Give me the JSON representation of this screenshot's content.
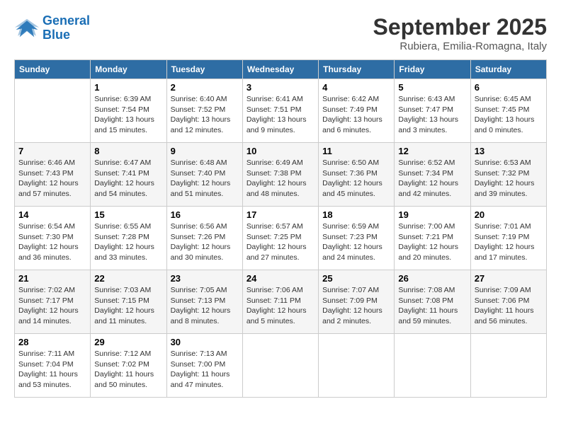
{
  "logo": {
    "line1": "General",
    "line2": "Blue"
  },
  "title": "September 2025",
  "subtitle": "Rubiera, Emilia-Romagna, Italy",
  "days_of_week": [
    "Sunday",
    "Monday",
    "Tuesday",
    "Wednesday",
    "Thursday",
    "Friday",
    "Saturday"
  ],
  "weeks": [
    [
      {
        "day": "",
        "info": ""
      },
      {
        "day": "1",
        "info": "Sunrise: 6:39 AM\nSunset: 7:54 PM\nDaylight: 13 hours\nand 15 minutes."
      },
      {
        "day": "2",
        "info": "Sunrise: 6:40 AM\nSunset: 7:52 PM\nDaylight: 13 hours\nand 12 minutes."
      },
      {
        "day": "3",
        "info": "Sunrise: 6:41 AM\nSunset: 7:51 PM\nDaylight: 13 hours\nand 9 minutes."
      },
      {
        "day": "4",
        "info": "Sunrise: 6:42 AM\nSunset: 7:49 PM\nDaylight: 13 hours\nand 6 minutes."
      },
      {
        "day": "5",
        "info": "Sunrise: 6:43 AM\nSunset: 7:47 PM\nDaylight: 13 hours\nand 3 minutes."
      },
      {
        "day": "6",
        "info": "Sunrise: 6:45 AM\nSunset: 7:45 PM\nDaylight: 13 hours\nand 0 minutes."
      }
    ],
    [
      {
        "day": "7",
        "info": "Sunrise: 6:46 AM\nSunset: 7:43 PM\nDaylight: 12 hours\nand 57 minutes."
      },
      {
        "day": "8",
        "info": "Sunrise: 6:47 AM\nSunset: 7:41 PM\nDaylight: 12 hours\nand 54 minutes."
      },
      {
        "day": "9",
        "info": "Sunrise: 6:48 AM\nSunset: 7:40 PM\nDaylight: 12 hours\nand 51 minutes."
      },
      {
        "day": "10",
        "info": "Sunrise: 6:49 AM\nSunset: 7:38 PM\nDaylight: 12 hours\nand 48 minutes."
      },
      {
        "day": "11",
        "info": "Sunrise: 6:50 AM\nSunset: 7:36 PM\nDaylight: 12 hours\nand 45 minutes."
      },
      {
        "day": "12",
        "info": "Sunrise: 6:52 AM\nSunset: 7:34 PM\nDaylight: 12 hours\nand 42 minutes."
      },
      {
        "day": "13",
        "info": "Sunrise: 6:53 AM\nSunset: 7:32 PM\nDaylight: 12 hours\nand 39 minutes."
      }
    ],
    [
      {
        "day": "14",
        "info": "Sunrise: 6:54 AM\nSunset: 7:30 PM\nDaylight: 12 hours\nand 36 minutes."
      },
      {
        "day": "15",
        "info": "Sunrise: 6:55 AM\nSunset: 7:28 PM\nDaylight: 12 hours\nand 33 minutes."
      },
      {
        "day": "16",
        "info": "Sunrise: 6:56 AM\nSunset: 7:26 PM\nDaylight: 12 hours\nand 30 minutes."
      },
      {
        "day": "17",
        "info": "Sunrise: 6:57 AM\nSunset: 7:25 PM\nDaylight: 12 hours\nand 27 minutes."
      },
      {
        "day": "18",
        "info": "Sunrise: 6:59 AM\nSunset: 7:23 PM\nDaylight: 12 hours\nand 24 minutes."
      },
      {
        "day": "19",
        "info": "Sunrise: 7:00 AM\nSunset: 7:21 PM\nDaylight: 12 hours\nand 20 minutes."
      },
      {
        "day": "20",
        "info": "Sunrise: 7:01 AM\nSunset: 7:19 PM\nDaylight: 12 hours\nand 17 minutes."
      }
    ],
    [
      {
        "day": "21",
        "info": "Sunrise: 7:02 AM\nSunset: 7:17 PM\nDaylight: 12 hours\nand 14 minutes."
      },
      {
        "day": "22",
        "info": "Sunrise: 7:03 AM\nSunset: 7:15 PM\nDaylight: 12 hours\nand 11 minutes."
      },
      {
        "day": "23",
        "info": "Sunrise: 7:05 AM\nSunset: 7:13 PM\nDaylight: 12 hours\nand 8 minutes."
      },
      {
        "day": "24",
        "info": "Sunrise: 7:06 AM\nSunset: 7:11 PM\nDaylight: 12 hours\nand 5 minutes."
      },
      {
        "day": "25",
        "info": "Sunrise: 7:07 AM\nSunset: 7:09 PM\nDaylight: 12 hours\nand 2 minutes."
      },
      {
        "day": "26",
        "info": "Sunrise: 7:08 AM\nSunset: 7:08 PM\nDaylight: 11 hours\nand 59 minutes."
      },
      {
        "day": "27",
        "info": "Sunrise: 7:09 AM\nSunset: 7:06 PM\nDaylight: 11 hours\nand 56 minutes."
      }
    ],
    [
      {
        "day": "28",
        "info": "Sunrise: 7:11 AM\nSunset: 7:04 PM\nDaylight: 11 hours\nand 53 minutes."
      },
      {
        "day": "29",
        "info": "Sunrise: 7:12 AM\nSunset: 7:02 PM\nDaylight: 11 hours\nand 50 minutes."
      },
      {
        "day": "30",
        "info": "Sunrise: 7:13 AM\nSunset: 7:00 PM\nDaylight: 11 hours\nand 47 minutes."
      },
      {
        "day": "",
        "info": ""
      },
      {
        "day": "",
        "info": ""
      },
      {
        "day": "",
        "info": ""
      },
      {
        "day": "",
        "info": ""
      }
    ]
  ]
}
